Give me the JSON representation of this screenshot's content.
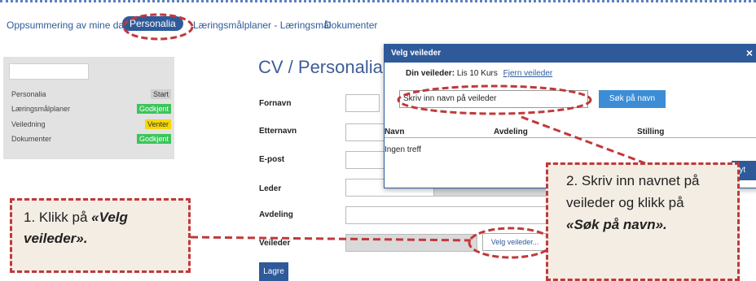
{
  "nav": {
    "tabs": [
      "Oppsummering av mine data",
      "Personalia",
      "Læringsmålplaner - Læringsmål",
      "Dokumenter"
    ]
  },
  "sidebar": {
    "items": [
      {
        "label": "Personalia",
        "badge": "Start"
      },
      {
        "label": "Læringsmålplaner",
        "badge": "Godkjent"
      },
      {
        "label": "Veiledning",
        "badge": "Venter"
      },
      {
        "label": "Dokumenter",
        "badge": "Godkjent"
      }
    ]
  },
  "form": {
    "title": "CV / Personalia",
    "labels": [
      "Fornavn",
      "Etternavn",
      "E-post",
      "Leder",
      "Avdeling",
      "Veileder"
    ],
    "velg_button": "Velg veileder...",
    "save_button": "Lagre"
  },
  "dialog": {
    "title": "Velg veileder",
    "close": "×",
    "current_label": "Din veileder:",
    "current_value": "Lis 10 Kurs",
    "remove_link": "Fjern veileder",
    "search_value": "Skriv inn navn på veileder",
    "search_button": "Søk på navn",
    "columns": [
      "Navn",
      "Avdeling",
      "Stilling"
    ],
    "empty_text": "Ingen treff",
    "close_button_partial": "ryt"
  },
  "callouts": {
    "c1_plain": "1. Klikk på ",
    "c1_em": "«Velg veileder».",
    "c2_plain": "2. Skriv inn navnet på veileder og klikk på ",
    "c2_em": "«Søk på navn»."
  },
  "colors": {
    "accent": "#2f5a9a",
    "annotation": "#c0393b",
    "callout_bg": "#f3ede4"
  }
}
